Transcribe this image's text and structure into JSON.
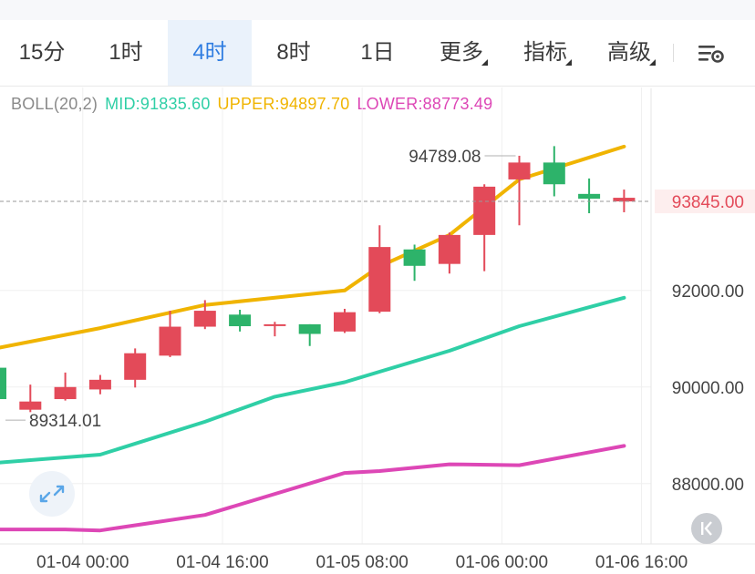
{
  "tabs": [
    {
      "label": "15分",
      "active": false,
      "dropdown": false
    },
    {
      "label": "1时",
      "active": false,
      "dropdown": false
    },
    {
      "label": "4时",
      "active": true,
      "dropdown": false
    },
    {
      "label": "8时",
      "active": false,
      "dropdown": false
    },
    {
      "label": "1日",
      "active": false,
      "dropdown": false
    },
    {
      "label": "更多",
      "active": false,
      "dropdown": true
    },
    {
      "label": "指标",
      "active": false,
      "dropdown": true
    },
    {
      "label": "高级",
      "active": false,
      "dropdown": true
    }
  ],
  "indicator": {
    "name": "BOLL(20,2)",
    "mid": "MID:91835.60",
    "upper": "UPPER:94897.70",
    "lower": "LOWER:88773.49"
  },
  "icons": {
    "settings": "chart-settings-icon",
    "expand": "expand-arrows-icon",
    "scroll_to_latest": "double-chevron-left-icon"
  },
  "colors": {
    "up": "#2db36a",
    "down": "#e34a59",
    "mid": "#2fcfa6",
    "upper": "#f0b400",
    "lower": "#dd47b6",
    "accent": "#2f7de1"
  },
  "chart_data": {
    "type": "candlestick",
    "ylim": [
      86750,
      95450
    ],
    "y_ticks": [
      88000,
      90000,
      92000
    ],
    "y_tick_labels": [
      "88000.00",
      "90000.00",
      "92000.00"
    ],
    "x_tick_labels": [
      "01-04 00:00",
      "01-04 16:00",
      "01-05 08:00",
      "01-06 00:00",
      "01-06 16:00"
    ],
    "x_tick_index": [
      2.5,
      6.5,
      10.5,
      14.5,
      18.5
    ],
    "last_price": 93845,
    "last_price_label": "93845.00",
    "high_marker": {
      "index": 15,
      "value": 94789.08,
      "label": "94789.08"
    },
    "low_marker": {
      "index": 0.5,
      "value": 89314.01,
      "label": "89314.01"
    },
    "candles": [
      {
        "o": 89750,
        "h": 90400,
        "l": 89580,
        "c": 90400
      },
      {
        "o": 89700,
        "h": 90050,
        "l": 89480,
        "c": 89530
      },
      {
        "o": 90000,
        "h": 90300,
        "l": 89720,
        "c": 89750
      },
      {
        "o": 90150,
        "h": 90250,
        "l": 89850,
        "c": 89950
      },
      {
        "o": 90700,
        "h": 90800,
        "l": 89990,
        "c": 90150
      },
      {
        "o": 91250,
        "h": 91580,
        "l": 90620,
        "c": 90650
      },
      {
        "o": 91580,
        "h": 91800,
        "l": 91200,
        "c": 91250
      },
      {
        "o": 91260,
        "h": 91600,
        "l": 91150,
        "c": 91500
      },
      {
        "o": 91300,
        "h": 91350,
        "l": 91050,
        "c": 91270
      },
      {
        "o": 91100,
        "h": 91300,
        "l": 90850,
        "c": 91300
      },
      {
        "o": 91550,
        "h": 91620,
        "l": 91120,
        "c": 91150
      },
      {
        "o": 92900,
        "h": 93350,
        "l": 91530,
        "c": 91560
      },
      {
        "o": 92510,
        "h": 92950,
        "l": 92200,
        "c": 92850
      },
      {
        "o": 93150,
        "h": 93200,
        "l": 92350,
        "c": 92550
      },
      {
        "o": 94150,
        "h": 94200,
        "l": 92400,
        "c": 93150
      },
      {
        "o": 94650,
        "h": 94790,
        "l": 93350,
        "c": 94300
      },
      {
        "o": 94200,
        "h": 94990,
        "l": 93950,
        "c": 94650
      },
      {
        "o": 93900,
        "h": 94320,
        "l": 93600,
        "c": 94000
      },
      {
        "o": 93920,
        "h": 94090,
        "l": 93620,
        "c": 93845
      }
    ],
    "series": [
      {
        "name": "UPPER",
        "x": [
          0,
          3,
          6,
          8,
          10,
          11,
          13,
          15,
          18
        ],
        "values": [
          90800,
          91220,
          91700,
          91850,
          92000,
          92500,
          93150,
          94300,
          94980
        ]
      },
      {
        "name": "MID",
        "x": [
          0,
          3,
          6,
          8,
          10,
          13,
          15,
          18
        ],
        "values": [
          88430,
          88600,
          89280,
          89800,
          90100,
          90750,
          91260,
          91850
        ]
      },
      {
        "name": "LOWER",
        "x": [
          0,
          2,
          3,
          6,
          10,
          11,
          13,
          15,
          18
        ],
        "values": [
          87050,
          87050,
          87030,
          87350,
          88220,
          88260,
          88400,
          88380,
          88780
        ]
      }
    ]
  }
}
